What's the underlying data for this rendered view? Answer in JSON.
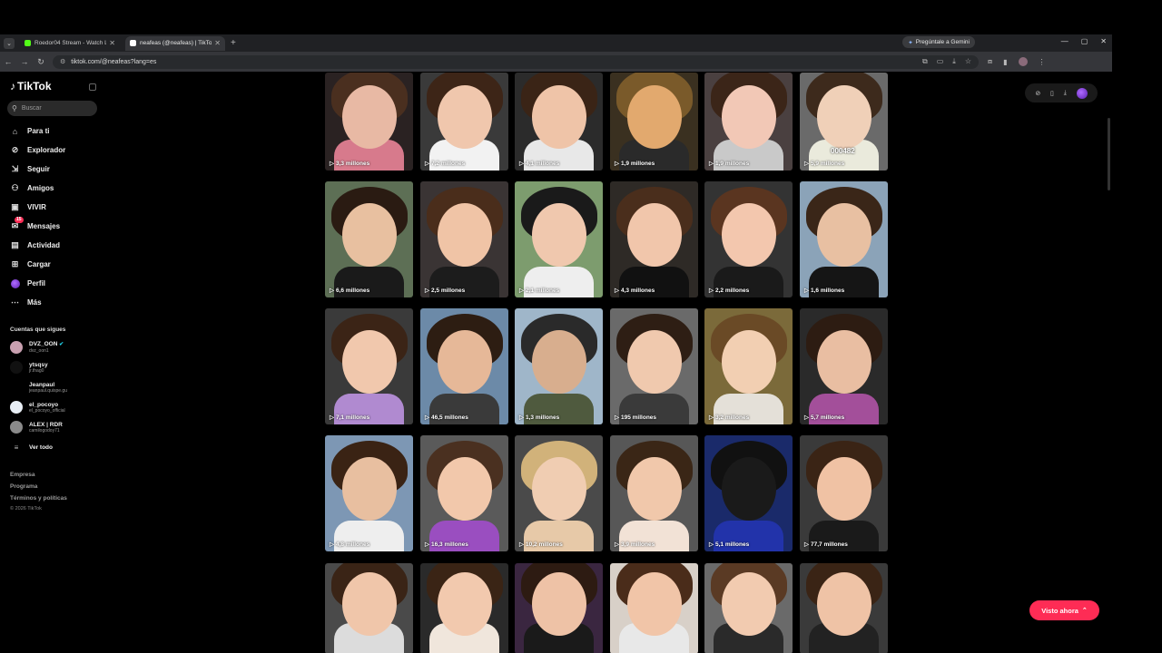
{
  "browser": {
    "tabs": [
      {
        "title": "Roedor04 Stream - Watch Live",
        "favicon_color": "#53fc18",
        "active": false
      },
      {
        "title": "neafeas (@neafeas) | TikTok",
        "favicon_color": "#ffffff",
        "active": true
      }
    ],
    "gemini_button": "Pregúntale a Gemini",
    "url": "tiktok.com/@neafeas?lang=es"
  },
  "sidebar": {
    "logo": "TikTok",
    "search_placeholder": "Buscar",
    "nav": [
      {
        "label": "Para ti",
        "icon": "home-icon"
      },
      {
        "label": "Explorador",
        "icon": "compass-icon"
      },
      {
        "label": "Seguir",
        "icon": "following-icon"
      },
      {
        "label": "Amigos",
        "icon": "friends-icon"
      },
      {
        "label": "VIVIR",
        "icon": "live-icon"
      },
      {
        "label": "Mensajes",
        "icon": "messages-icon",
        "badge": "15"
      },
      {
        "label": "Actividad",
        "icon": "activity-icon"
      },
      {
        "label": "Cargar",
        "icon": "upload-icon"
      },
      {
        "label": "Perfil",
        "icon": "profile-avatar-icon"
      },
      {
        "label": "Más",
        "icon": "more-icon"
      }
    ],
    "following_title": "Cuentas que sigues",
    "following": [
      {
        "name": "DVZ_OON",
        "handle": "dvz_oon1",
        "avatar_color": "#c9a0b0",
        "verified": true
      },
      {
        "name": "ytsqsy",
        "handle": "jr.thag0",
        "avatar_color": "#111111",
        "verified": false
      },
      {
        "name": "Jeanpaul",
        "handle": "jeanpaul.quispe.gu",
        "avatar_color": "#000000",
        "verified": false
      },
      {
        "name": "el_pocoyo",
        "handle": "el_pocoyo_official",
        "avatar_color": "#e8eef5",
        "verified": false
      },
      {
        "name": "ALEX | RDR",
        "handle": "camilogodoy71",
        "avatar_color": "#8a8a8a",
        "verified": false
      }
    ],
    "see_all": "Ver todo",
    "footer": [
      "Empresa",
      "Programa",
      "Términos y políticas",
      "© 2026 TikTok"
    ]
  },
  "videos": [
    {
      "views": "3,3 millones",
      "bg": "#2a2222",
      "hair": "#4a2f1f",
      "face": "#e8b9a4",
      "body": "#d77a8c"
    },
    {
      "views": "7,2 millones",
      "bg": "#3a3a3a",
      "hair": "#3d2517",
      "face": "#f0c7ad",
      "body": "#f2f2f2"
    },
    {
      "views": "4,1 millones",
      "bg": "#2b2b2b",
      "hair": "#3a2416",
      "face": "#efc4a8",
      "body": "#e8e8e8"
    },
    {
      "views": "1,9 millones",
      "bg": "#3a3020",
      "hair": "#7a5a2a",
      "face": "#e2a96e",
      "body": "#2a2a2a"
    },
    {
      "views": "1,9 millones",
      "bg": "#4a4040",
      "hair": "#3b2518",
      "face": "#f2c8b6",
      "body": "#c9c9c9"
    },
    {
      "views": "5,9 millones",
      "bg": "#6a6a6a",
      "hair": "#3d2a1c",
      "face": "#f0d0b8",
      "body": "#eaeadc",
      "counter": "000482"
    },
    {
      "views": "6,6 millones",
      "bg": "#5d6f55",
      "hair": "#2a1b12",
      "face": "#e8c0a0",
      "body": "#1a1a1a"
    },
    {
      "views": "2,5 millones",
      "bg": "#3a3434",
      "hair": "#4a2d1b",
      "face": "#f0c4a6",
      "body": "#1c1c1c"
    },
    {
      "views": "2,1 millones",
      "bg": "#7d9c6e",
      "hair": "#1a1a1a",
      "face": "#f0c8ae",
      "body": "#eeeeee"
    },
    {
      "views": "4,3 millones",
      "bg": "#2e2a26",
      "hair": "#4a2e1c",
      "face": "#f1c6ab",
      "body": "#111111"
    },
    {
      "views": "2,2 millones",
      "bg": "#333333",
      "hair": "#5a3520",
      "face": "#f3c7ae",
      "body": "#1a1a1a"
    },
    {
      "views": "1,6 millones",
      "bg": "#8ba3b8",
      "hair": "#3a2618",
      "face": "#e8c0a2",
      "body": "#151515"
    },
    {
      "views": "7,1 millones",
      "bg": "#3a3a3a",
      "hair": "#3b2416",
      "face": "#f1c8ad",
      "body": "#b08ad0"
    },
    {
      "views": "46,5 millones",
      "bg": "#6c8aa8",
      "hair": "#2d1d12",
      "face": "#e6b898",
      "body": "#3a3a3a"
    },
    {
      "views": "1,3 millones",
      "bg": "#9fb6c9",
      "hair": "#2a2a2a",
      "face": "#d8ae8e",
      "body": "#4f5a3e"
    },
    {
      "views": "195 millones",
      "bg": "#6a6a6a",
      "hair": "#2e1e14",
      "face": "#f0c9ae",
      "body": "#3a3a3a"
    },
    {
      "views": "3,2 millones",
      "bg": "#7b6a3a",
      "hair": "#6a4a26",
      "face": "#f2cfb2",
      "body": "#e4e0d8"
    },
    {
      "views": "5,7 millones",
      "bg": "#2a2a2a",
      "hair": "#2d1c12",
      "face": "#e9bea2",
      "body": "#a34f9a"
    },
    {
      "views": "4,8 millones",
      "bg": "#7d97b4",
      "hair": "#3a2314",
      "face": "#e8bfa0",
      "body": "#eeeeee"
    },
    {
      "views": "16,3 millones",
      "bg": "#5a5a5a",
      "hair": "#4a3020",
      "face": "#f2c8ab",
      "body": "#9a4ec0"
    },
    {
      "views": "10,2 millones",
      "bg": "#4a4a4a",
      "hair": "#d1b27a",
      "face": "#f0cdb2",
      "body": "#e7c9a8"
    },
    {
      "views": "3,9 millones",
      "bg": "#575757",
      "hair": "#3a2616",
      "face": "#f1c8ab",
      "body": "#f2e2d6"
    },
    {
      "views": "5,1 millones",
      "bg": "#1a2a6a",
      "hair": "#111111",
      "face": "#1a1a1a",
      "body": "#2233aa"
    },
    {
      "views": "77,7 millones",
      "bg": "#3a3a3a",
      "hair": "#3a2415",
      "face": "#f0c2a4",
      "body": "#1a1a1a"
    },
    {
      "views": "",
      "bg": "#4a4a4a",
      "hair": "#3a2416",
      "face": "#f0c6aa",
      "body": "#dcdcdc"
    },
    {
      "views": "",
      "bg": "#2a2a2a",
      "hair": "#3a2415",
      "face": "#f2c9ae",
      "body": "#f0e6dc"
    },
    {
      "views": "",
      "bg": "#3a2640",
      "hair": "#2d1b12",
      "face": "#eec2a6",
      "body": "#1a1a1a"
    },
    {
      "views": "",
      "bg": "#d8d0c8",
      "hair": "#4a2c1a",
      "face": "#f1c5a8",
      "body": "#e8e8e8"
    },
    {
      "views": "",
      "bg": "#6a6a6a",
      "hair": "#5a3a24",
      "face": "#f2cbb0",
      "body": "#2a2a2a"
    },
    {
      "views": "",
      "bg": "#3a3a3a",
      "hair": "#3a2415",
      "face": "#efc3a6",
      "body": "#222222"
    }
  ],
  "float_toolbar": [
    "compass-icon",
    "phone-icon",
    "download-icon",
    "profile-avatar-icon"
  ],
  "watched_button": "Visto ahora"
}
